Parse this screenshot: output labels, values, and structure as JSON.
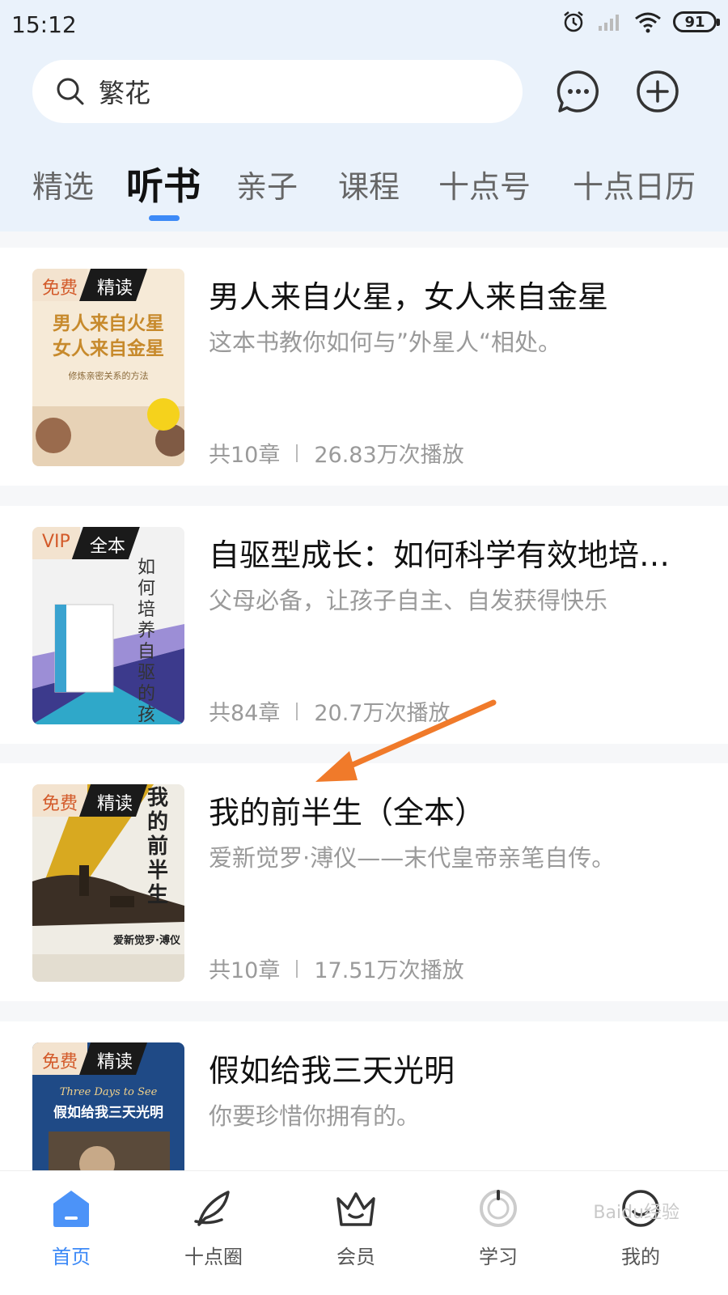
{
  "status_bar": {
    "time": "15:12",
    "battery": "91"
  },
  "search": {
    "text": "繁花"
  },
  "tabs": [
    {
      "label": "精选"
    },
    {
      "label": "听书"
    },
    {
      "label": "亲子"
    },
    {
      "label": "课程"
    },
    {
      "label": "十点号"
    },
    {
      "label": "十点日历"
    }
  ],
  "books": [
    {
      "badge_a": "免费",
      "badge_b": "精读",
      "title": "男人来自火星，女人来自金星",
      "desc": "这本书教你如何与”外星人“相处。",
      "chapters": "共10章",
      "plays": "26.83万次播放",
      "cover_title": "男人来自火星\n女人来自金星",
      "cover_sub": "修炼亲密关系的方法"
    },
    {
      "badge_a": "VIP",
      "badge_b": "全本",
      "title": "自驱型成长：如何科学有效地培…",
      "desc": "父母必备，让孩子自主、自发获得快乐",
      "chapters": "共84章",
      "plays": "20.7万次播放",
      "cover_title": "如何培养自驱的孩子"
    },
    {
      "badge_a": "免费",
      "badge_b": "精读",
      "title": "我的前半生（全本）",
      "desc": "爱新觉罗·溥仪——末代皇帝亲笔自传。",
      "chapters": "共10章",
      "plays": "17.51万次播放",
      "cover_title": "我的前半生",
      "cover_author": "爱新觉罗·溥仪"
    },
    {
      "badge_a": "免费",
      "badge_b": "精读",
      "title": "假如给我三天光明",
      "desc": "你要珍惜你拥有的。",
      "cover_title": "假如给我三天光明",
      "cover_en": "Three Days to See"
    }
  ],
  "bottom_nav": [
    {
      "label": "首页"
    },
    {
      "label": "十点圈"
    },
    {
      "label": "会员"
    },
    {
      "label": "学习"
    },
    {
      "label": "我的"
    }
  ],
  "watermark": "Baidu经验"
}
